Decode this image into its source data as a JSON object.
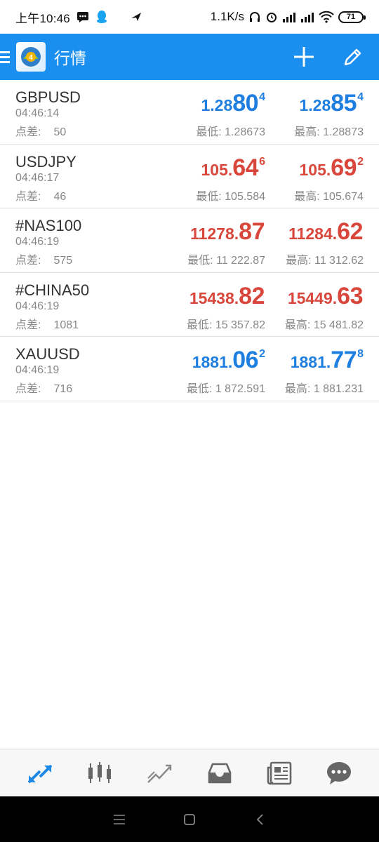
{
  "status_bar": {
    "time": "上午10:46",
    "net_speed": "1.1K/s",
    "battery": "71"
  },
  "toolbar": {
    "title": "行情"
  },
  "labels": {
    "spread": "点差:",
    "low": "最低:",
    "high": "最高:"
  },
  "colors": {
    "accent": "#1a8ff0",
    "up": "#1e7fe0",
    "down": "#d9473c"
  },
  "quotes": [
    {
      "symbol": "GBPUSD",
      "time": "04:46:14",
      "spread": "50",
      "direction": "up",
      "bid": {
        "small": "1.28",
        "big": "80",
        "pip": "4"
      },
      "ask": {
        "small": "1.28",
        "big": "85",
        "pip": "4"
      },
      "low": "1.28673",
      "high": "1.28873"
    },
    {
      "symbol": "USDJPY",
      "time": "04:46:17",
      "spread": "46",
      "direction": "down",
      "bid": {
        "small": "105.",
        "big": "64",
        "pip": "6"
      },
      "ask": {
        "small": "105.",
        "big": "69",
        "pip": "2"
      },
      "low": "105.584",
      "high": "105.674"
    },
    {
      "symbol": "#NAS100",
      "time": "04:46:19",
      "spread": "575",
      "direction": "down",
      "bid": {
        "small": "11278.",
        "big": "87",
        "pip": ""
      },
      "ask": {
        "small": "11284.",
        "big": "62",
        "pip": ""
      },
      "low": "11 222.87",
      "high": "11 312.62"
    },
    {
      "symbol": "#CHINA50",
      "time": "04:46:19",
      "spread": "1081",
      "direction": "down",
      "bid": {
        "small": "15438.",
        "big": "82",
        "pip": ""
      },
      "ask": {
        "small": "15449.",
        "big": "63",
        "pip": ""
      },
      "low": "15 357.82",
      "high": "15 481.82"
    },
    {
      "symbol": "XAUUSD",
      "time": "04:46:19",
      "spread": "716",
      "direction": "up",
      "bid": {
        "small": "1881.",
        "big": "06",
        "pip": "2"
      },
      "ask": {
        "small": "1881.",
        "big": "77",
        "pip": "8"
      },
      "low": "1 872.591",
      "high": "1 881.231"
    }
  ],
  "bottom_nav": {
    "items": [
      "quotes-icon",
      "chart-icon",
      "trade-icon",
      "history-icon",
      "news-icon",
      "chat-icon"
    ],
    "active": "quotes-icon"
  }
}
